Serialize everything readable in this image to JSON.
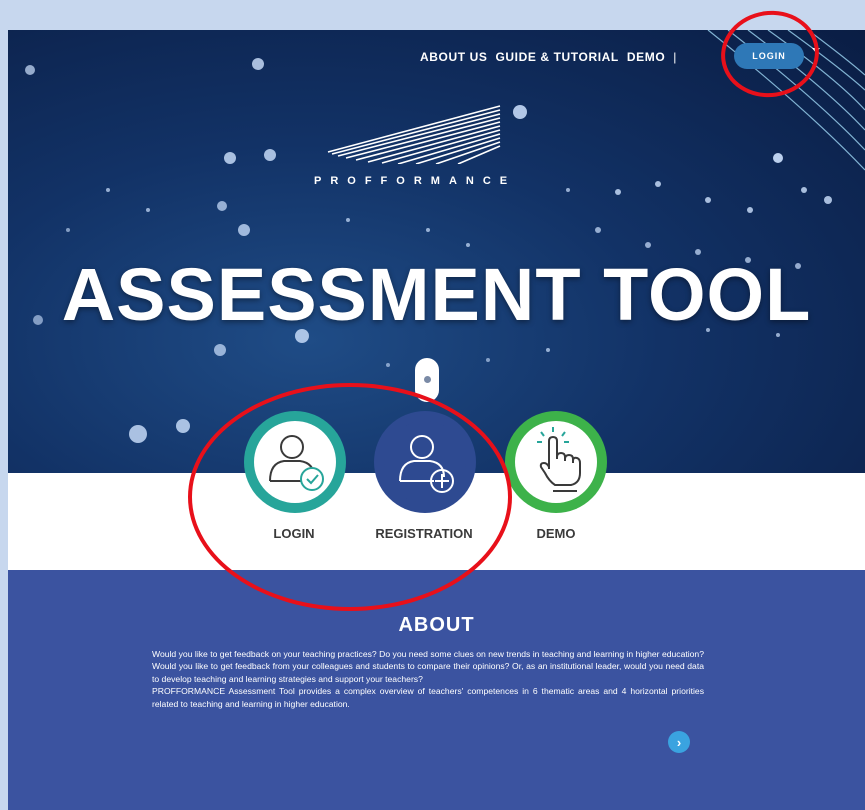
{
  "nav": {
    "items": [
      "ABOUT US",
      "GUIDE & TUTORIAL",
      "DEMO"
    ],
    "separator": "|",
    "login_label": "LOGIN"
  },
  "brand": {
    "name": "PROFFORMANCE"
  },
  "hero": {
    "title": "ASSESSMENT TOOL"
  },
  "actions": [
    {
      "label": "LOGIN",
      "color": "#27a59a",
      "icon": "user-check-icon"
    },
    {
      "label": "REGISTRATION",
      "color": "#2e4a91",
      "icon": "user-add-icon"
    },
    {
      "label": "DEMO",
      "color": "#3db24a",
      "icon": "hand-pointer-icon"
    }
  ],
  "about": {
    "title": "ABOUT",
    "paragraphs": [
      "Would you like to get feedback on your teaching practices? Do you need some clues on new trends in teaching and learning in higher education? Would you like to get feedback from your colleagues and students to compare their opinions? Or, as an institutional leader, would you need data to develop teaching and learning strategies and support your teachers?",
      "PROFFORMANCE Assessment Tool provides a complex overview of teachers' competences in 6 thematic areas and 4 horizontal priorities related to teaching and learning in higher education."
    ],
    "next_icon": "chevron-right-icon",
    "next_glyph": "›"
  },
  "colors": {
    "hero_bg": "#123266",
    "about_bg": "#3b53a0",
    "login_pill": "#2e78b7",
    "annotation": "#e8101a"
  }
}
